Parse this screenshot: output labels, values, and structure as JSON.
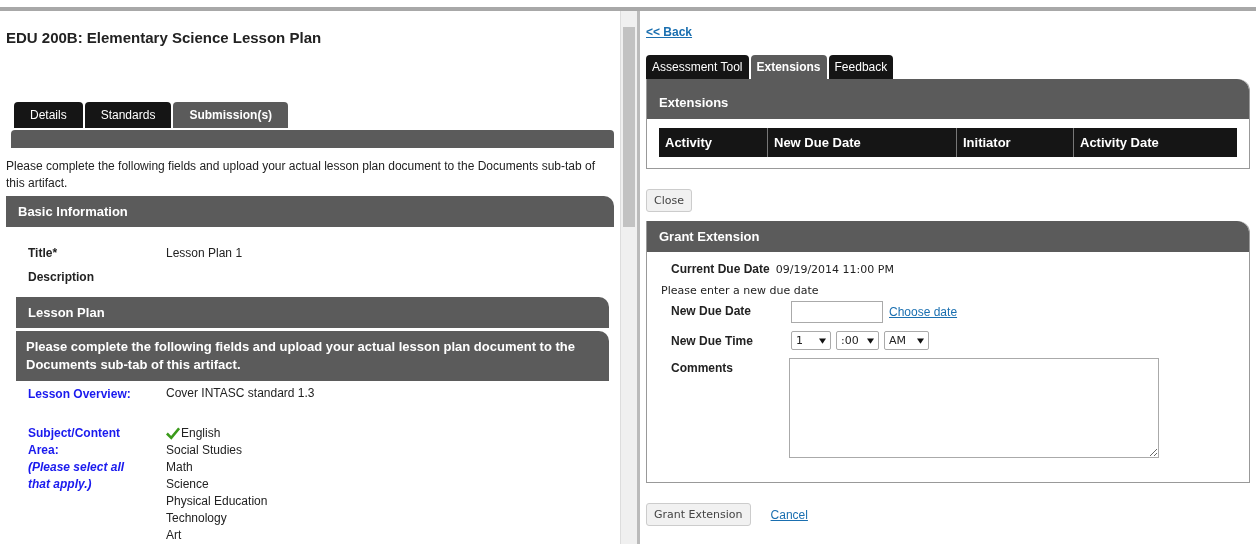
{
  "left": {
    "title": "EDU 200B: Elementary Science Lesson Plan",
    "tabs": [
      {
        "label": "Details",
        "selected": false
      },
      {
        "label": "Standards",
        "selected": false
      },
      {
        "label": "Submission(s)",
        "selected": true
      }
    ],
    "intro": "Please complete the following fields and upload your actual lesson plan document to the Documents sub-tab of this artifact.",
    "basic_information": {
      "heading": "Basic Information",
      "fields": [
        {
          "label": "Title*",
          "value": "Lesson Plan 1"
        },
        {
          "label": "Description"
        }
      ]
    },
    "lesson_plan": {
      "heading": "Lesson Plan",
      "instruction": "Please complete the following fields and upload your actual lesson plan document to the Documents sub-tab of this artifact.",
      "overview": {
        "label": "Lesson Overview:",
        "value": "Cover INTASC standard 1.3"
      },
      "subject": {
        "label": "Subject/Content Area:",
        "hint": "(Please select all that apply.)",
        "options": [
          {
            "label": "English",
            "checked": true
          },
          {
            "label": "Social Studies",
            "checked": false
          },
          {
            "label": "Math",
            "checked": false
          },
          {
            "label": "Science",
            "checked": false
          },
          {
            "label": "Physical Education",
            "checked": false
          },
          {
            "label": "Technology",
            "checked": false
          },
          {
            "label": "Art",
            "checked": false
          }
        ]
      }
    }
  },
  "right": {
    "back_link": "<< Back",
    "tabs": [
      {
        "label": "Assessment Tool",
        "selected": false
      },
      {
        "label": "Extensions",
        "selected": true
      },
      {
        "label": "Feedback",
        "selected": false
      }
    ],
    "extensions": {
      "heading": "Extensions",
      "columns": [
        "Activity",
        "New Due Date",
        "Initiator",
        "Activity Date"
      ]
    },
    "close_button": "Close",
    "grant_extension": {
      "heading": "Grant Extension",
      "current_due_date": {
        "label": "Current Due Date",
        "value": "09/19/2014 11:00 PM"
      },
      "prompt": "Please enter a new due date",
      "new_due_date": {
        "label": "New Due Date",
        "link": "Choose date"
      },
      "new_due_time": {
        "label": "New Due Time",
        "hour": "1",
        "minute": ":00",
        "period": "AM"
      },
      "comments": {
        "label": "Comments"
      }
    },
    "grant_button": "Grant Extension",
    "cancel_link": "Cancel"
  }
}
